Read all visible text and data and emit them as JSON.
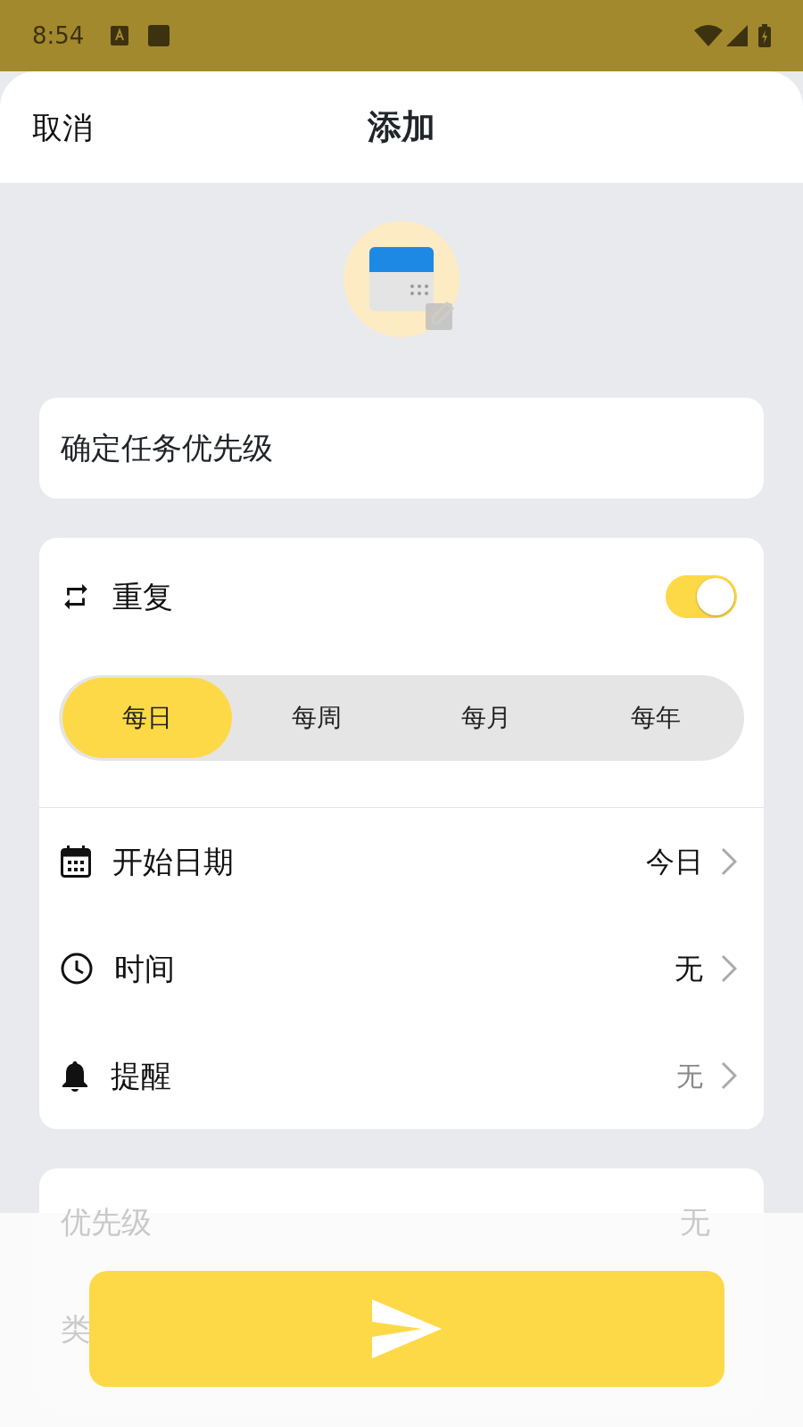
{
  "status_bar": {
    "time": "8:54"
  },
  "header": {
    "cancel": "取消",
    "title": "添加"
  },
  "task": {
    "title": "确定任务优先级"
  },
  "repeat": {
    "label": "重复",
    "on": true,
    "options": [
      {
        "label": "每日",
        "selected": true
      },
      {
        "label": "每周",
        "selected": false
      },
      {
        "label": "每月",
        "selected": false
      },
      {
        "label": "每年",
        "selected": false
      }
    ]
  },
  "settings": [
    {
      "label": "开始日期",
      "value": "今日",
      "dimmed": false
    },
    {
      "label": "时间",
      "value": "无",
      "dimmed": false
    },
    {
      "label": "提醒",
      "value": "无",
      "dimmed": true
    }
  ],
  "more": [
    {
      "label": "优先级",
      "value": "无"
    },
    {
      "label": "类"
    }
  ]
}
